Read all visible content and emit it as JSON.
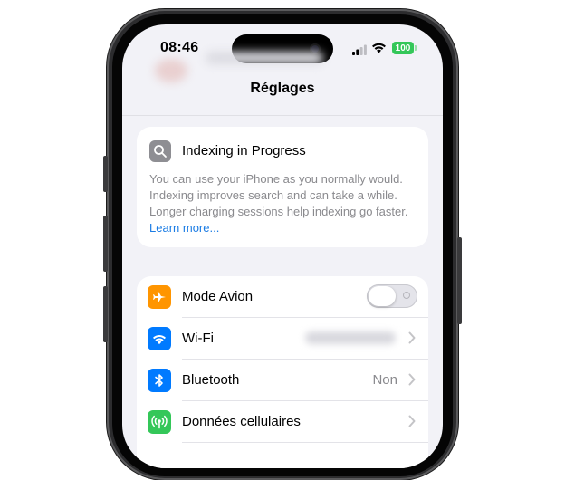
{
  "status_bar": {
    "time": "08:46",
    "battery": "100"
  },
  "nav": {
    "title": "Réglages"
  },
  "indexing_card": {
    "title": "Indexing in Progress",
    "body": "You can use your iPhone as you normally would. Indexing improves search and can take a while. Longer charging sessions help indexing go faster.",
    "link": "Learn more..."
  },
  "settings": {
    "rows": [
      {
        "label": "Mode Avion",
        "icon": "airplane-icon",
        "icon_color": "#ff9500",
        "toggle_on": false
      },
      {
        "label": "Wi-Fi",
        "icon": "wifi-icon",
        "icon_color": "#007aff"
      },
      {
        "label": "Bluetooth",
        "icon": "bluetooth-icon",
        "icon_color": "#007aff",
        "value": "Non"
      },
      {
        "label": "Données cellulaires",
        "icon": "cellular-icon",
        "icon_color": "#34c759"
      }
    ]
  },
  "colors": {
    "accent_link": "#1b7ce4",
    "background": "#f2f2f7"
  }
}
